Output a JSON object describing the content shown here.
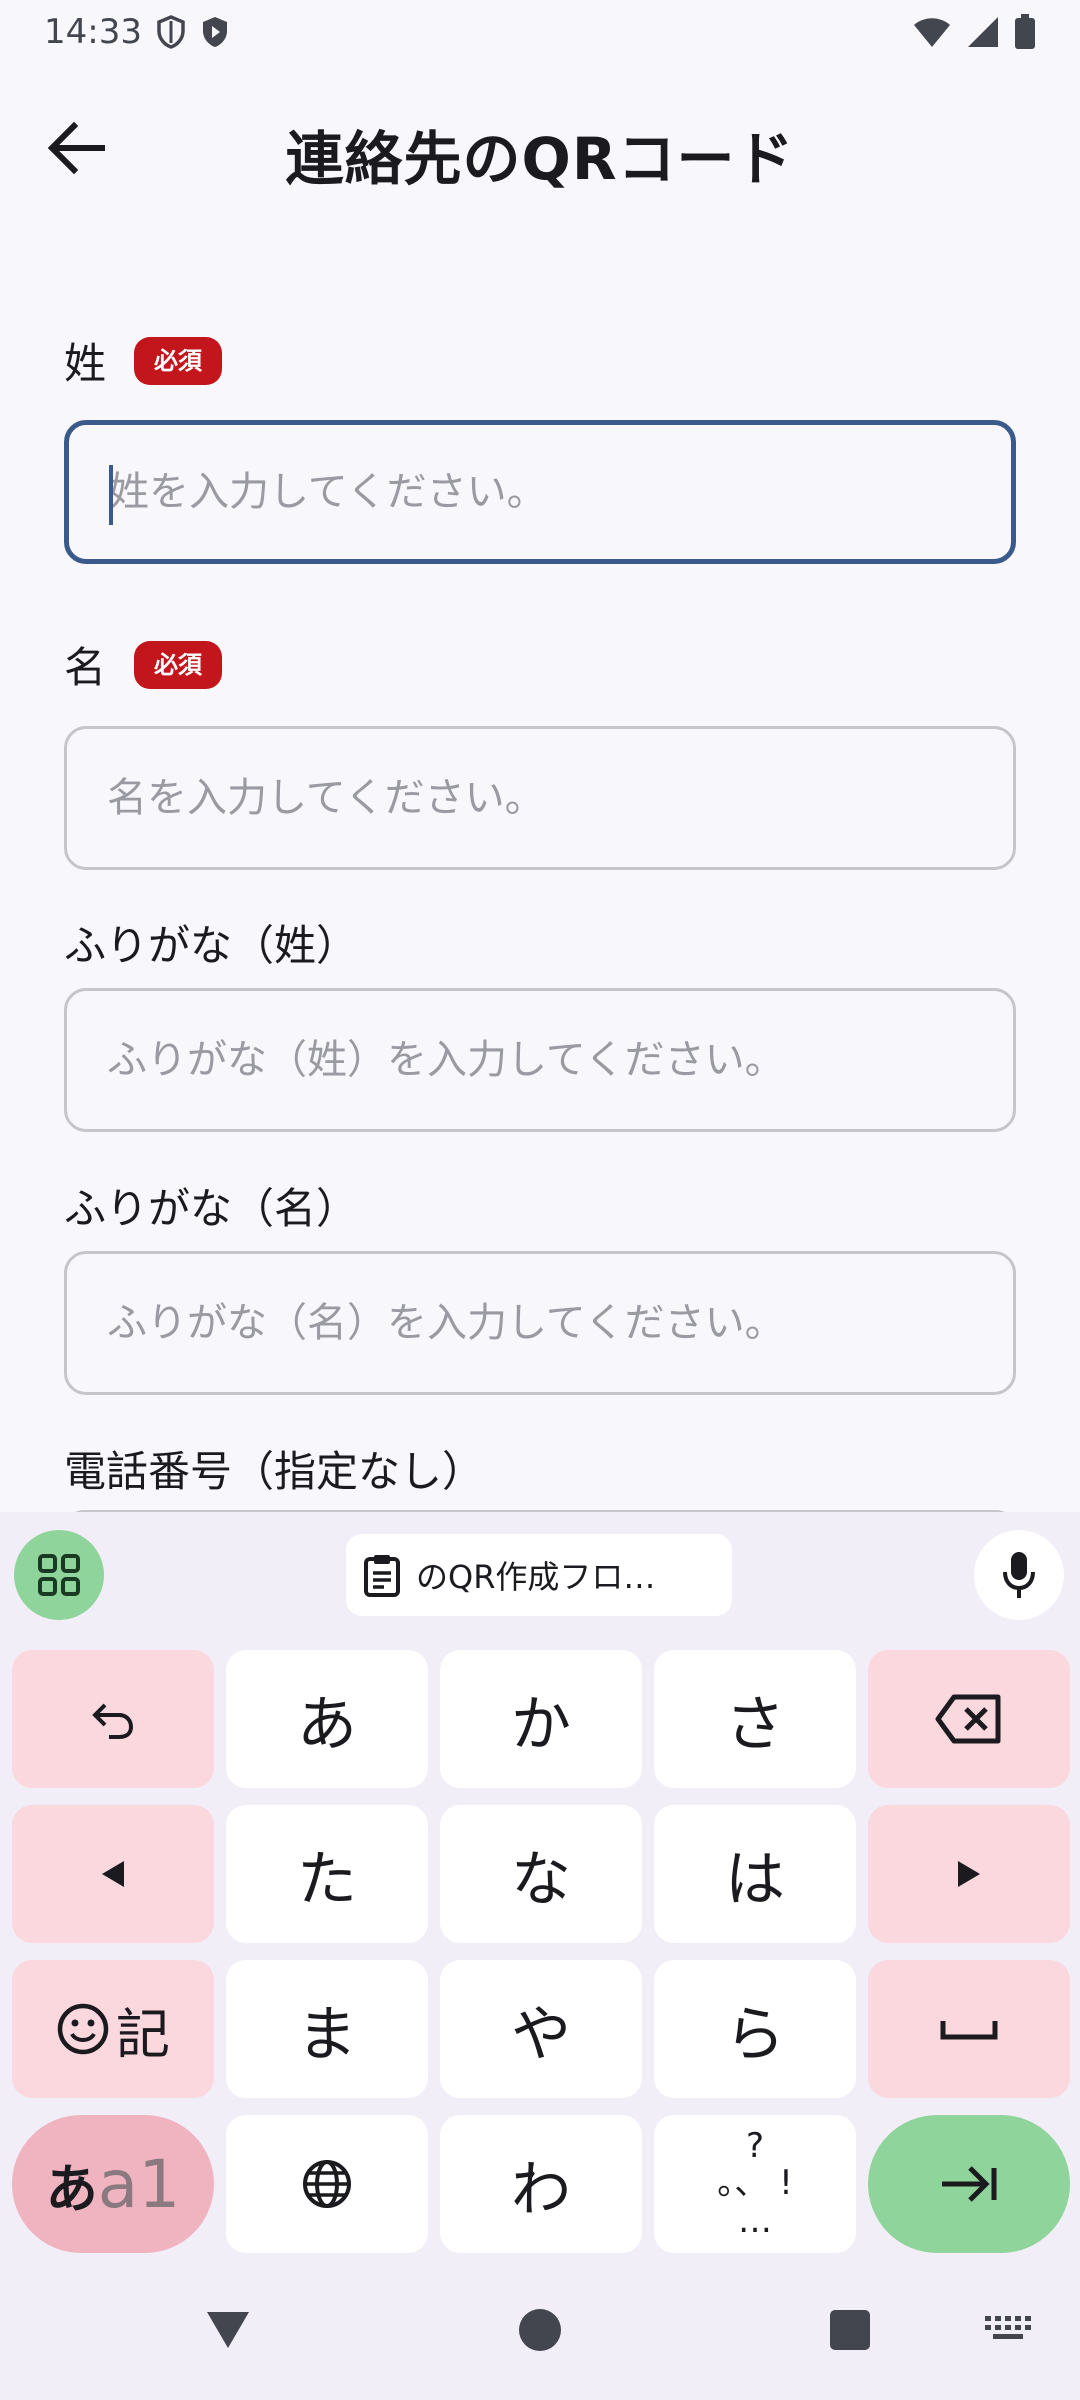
{
  "status_bar": {
    "time": "14:33"
  },
  "app_bar": {
    "title": "連絡先のQRコード"
  },
  "form": {
    "required_badge": "必須",
    "fields": [
      {
        "label": "姓",
        "placeholder": "姓を入力してください。",
        "required": true,
        "focused": true
      },
      {
        "label": "名",
        "placeholder": "名を入力してください。",
        "required": true,
        "focused": false
      },
      {
        "label": "ふりがな（姓）",
        "placeholder": "ふりがな（姓）を入力してください。",
        "required": false,
        "focused": false
      },
      {
        "label": "ふりがな（名）",
        "placeholder": "ふりがな（名）を入力してください。",
        "required": false,
        "focused": false
      },
      {
        "label": "電話番号（指定なし）",
        "placeholder": "",
        "required": false,
        "focused": false
      }
    ]
  },
  "keyboard": {
    "clipboard_chip": "のQR作成フロ…",
    "rows": [
      [
        "↶",
        "あ",
        "か",
        "さ",
        "⌫"
      ],
      [
        "◀",
        "た",
        "な",
        "は",
        "▶"
      ],
      [
        "☺記",
        "ま",
        "や",
        "ら",
        "␣"
      ],
      [
        "あa1",
        "🌐",
        "わ",
        "、。?!",
        "⇥"
      ]
    ],
    "emoji_label": "記",
    "mode_label_kana": "あ",
    "mode_label_alpha": "a1",
    "punct_top": "?",
    "punct_mid": "。、 !",
    "punct_bottom": "…"
  },
  "colors": {
    "accent": "#3b5a8c",
    "required": "#c3161c",
    "keyboard_fn": "#fbd7de",
    "keyboard_enter": "#8fd49a"
  }
}
